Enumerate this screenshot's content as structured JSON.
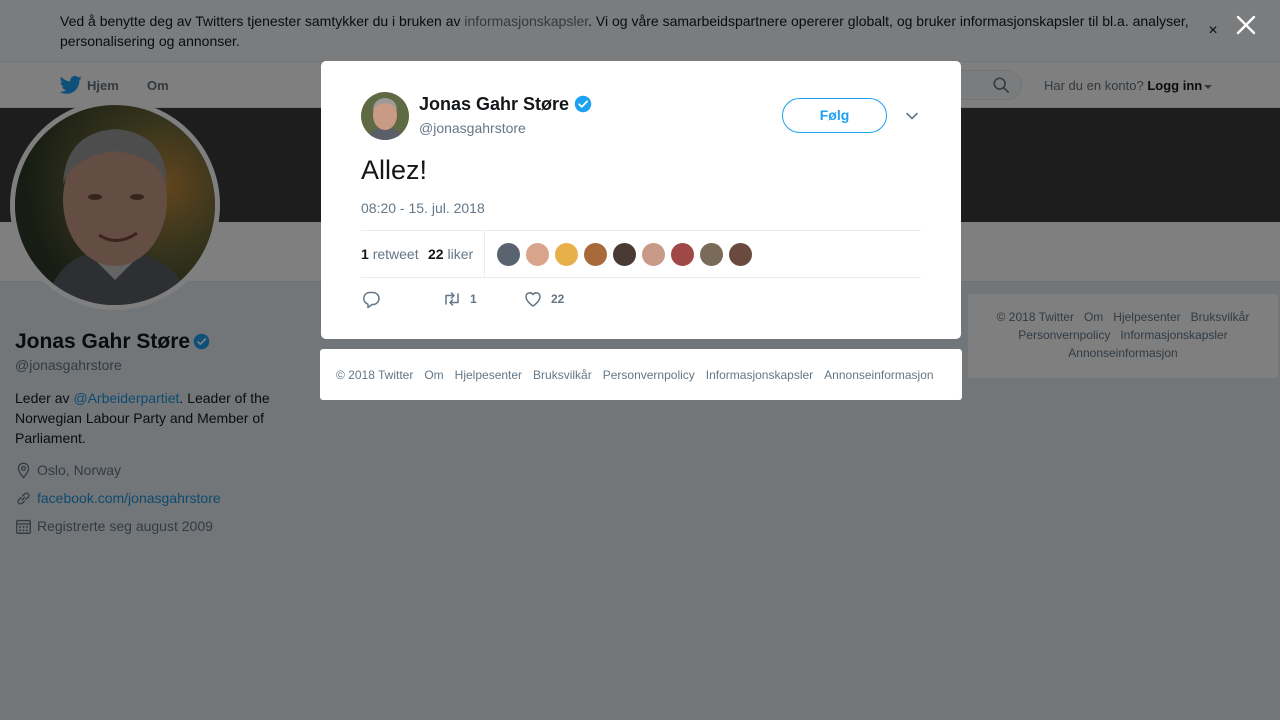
{
  "cookie_banner": {
    "text_before": "Ved å benytte deg av Twitters tjenester samtykker du i bruken av ",
    "link_text": "informasjonskapsler",
    "text_after": ". Vi og våre samarbeidspartnere opererer globalt, og bruker informasjonskapsler til bl.a. analyser, personalisering og annonser.",
    "close_symbol": "×"
  },
  "topnav": {
    "home_label": "Hjem",
    "about_label": "Om",
    "account_question": "Har du en konto?",
    "login_label": "Logg inn"
  },
  "profile": {
    "name": "Jonas Gahr Støre",
    "handle": "@jonasgahrstore",
    "bio_before": "Leder av ",
    "bio_mention": "@Arbeiderpartiet",
    "bio_after": ". Leader of the Norwegian Labour Party and Member of Parliament.",
    "location": "Oslo, Norway",
    "website": "facebook.com/jonasgahrstore",
    "joined": "Registrerte seg august 2009"
  },
  "side_footer": {
    "line1": [
      "© 2018 Twitter",
      "Om",
      "Hjelpesenter",
      "Bruksvilkår"
    ],
    "line2": [
      "Personvernpolicy",
      "Informasjonskapsler"
    ],
    "line3": [
      "Annonseinformasjon"
    ]
  },
  "tweet": {
    "author_name": "Jonas Gahr Støre",
    "author_handle": "@jonasgahrstore",
    "follow_label": "Følg",
    "text": "Allez!",
    "timestamp": "08:20 - 15. jul. 2018",
    "retweet_count": "1",
    "retweet_label": "retweet",
    "like_count": "22",
    "like_label": "liker",
    "action_retweet_count": "1",
    "action_like_count": "22",
    "liker_avatar_colors": [
      "#5a6470",
      "#d9a48c",
      "#e8b04a",
      "#a86a3a",
      "#4a3a34",
      "#c99a88",
      "#a04848",
      "#7a6a58",
      "#6a4a3e"
    ]
  },
  "modal_footer": {
    "links": [
      "© 2018 Twitter",
      "Om",
      "Hjelpesenter",
      "Bruksvilkår",
      "Personvernpolicy",
      "Informasjonskapsler",
      "Annonseinformasjon"
    ]
  },
  "colors": {
    "twitter_blue": "#1da1f2",
    "verified_blue": "#1da1f2",
    "banner": "#3b3b3b",
    "muted_text": "#657786"
  },
  "icons": {
    "nav_logo": "twitter-bird-icon",
    "search": "search-icon",
    "verified": "verified-badge-icon",
    "location": "location-pin-icon",
    "website": "link-icon",
    "joined": "calendar-icon",
    "close": "close-icon",
    "dropdown": "chevron-down-icon",
    "reply": "reply-icon",
    "retweet": "retweet-icon",
    "like": "heart-icon"
  }
}
